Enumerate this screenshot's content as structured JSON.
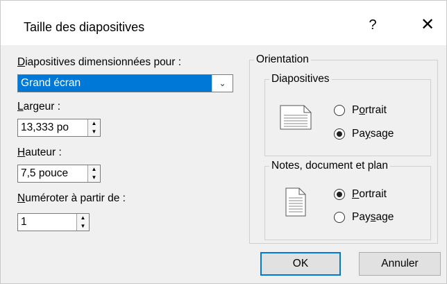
{
  "dialog": {
    "title": "Taille des diapositives",
    "help": "?",
    "close": "✕"
  },
  "size_for": {
    "label_first": "D",
    "label_rest": "iapositives dimensionnées pour :",
    "value": "Grand écran"
  },
  "width": {
    "label_first": "L",
    "label_rest": "argeur :",
    "value": "13,333 po"
  },
  "height": {
    "label_first": "H",
    "label_rest": "auteur :",
    "value": "7,5 pouce"
  },
  "number_from": {
    "label_first": "N",
    "label_rest": "uméroter à partir de :",
    "value": "1"
  },
  "orientation": {
    "title": "Orientation",
    "slides": {
      "title": "Diapositives",
      "portrait": {
        "pre": "P",
        "u": "o",
        "post": "rtrait",
        "checked": false
      },
      "landscape": {
        "pre": "Pa",
        "u": "y",
        "post": "sage",
        "checked": true
      }
    },
    "notes": {
      "title": "Notes, document et plan",
      "portrait": {
        "pre": "",
        "u": "P",
        "post": "ortrait",
        "checked": true
      },
      "landscape": {
        "pre": "Pay",
        "u": "s",
        "post": "age",
        "checked": false
      }
    }
  },
  "buttons": {
    "ok": "OK",
    "cancel": "Annuler"
  },
  "colors": {
    "accent": "#0078d7",
    "panel": "#f0f0f0"
  }
}
